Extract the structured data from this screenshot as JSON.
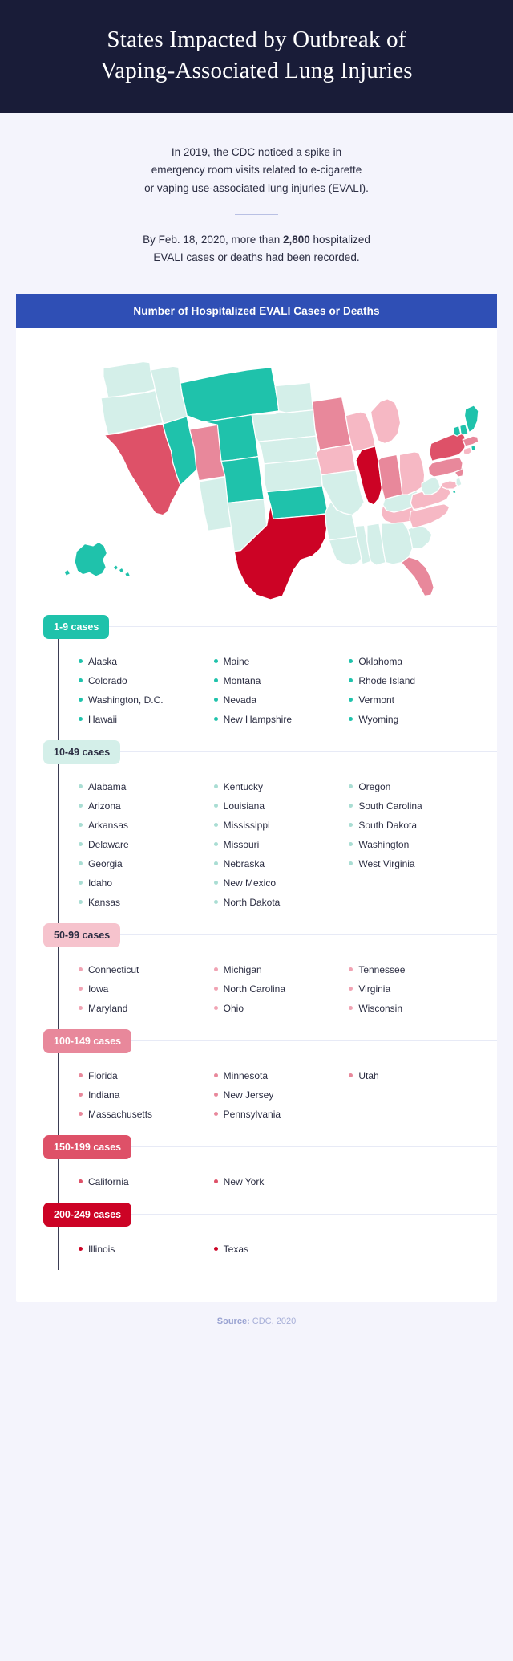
{
  "header": {
    "title_line1": "States Impacted by Outbreak of",
    "title_line2": "Vaping-Associated Lung Injuries"
  },
  "intro": {
    "para1_line1": "In 2019, the CDC noticed a spike in",
    "para1_line2": "emergency room visits related to e-cigarette",
    "para1_line3": "or vaping use-associated lung injuries (EVALI).",
    "para2_pre": "By Feb. 18, 2020, more than ",
    "para2_bold": "2,800",
    "para2_post": " hospitalized",
    "para2_line2": "EVALI cases or deaths had been recorded."
  },
  "card": {
    "title": "Number of Hospitalized EVALI Cases or Deaths"
  },
  "footer": {
    "source_label": "Source:",
    "source_value": " CDC, 2020"
  },
  "colors": {
    "header_bg": "#191c38",
    "page_bg": "#f4f4fc",
    "card_header_bg": "#2f4fb5",
    "bin_1_9": "#1fc2ab",
    "bin_10_49": "#d4efe9",
    "bin_50_99": "#f6b8c4",
    "bin_100_149": "#e8889b",
    "bin_150_199": "#de5168",
    "bin_200_249": "#cc0325",
    "map_stroke": "#ffffff",
    "timeline": "#3b3d54"
  },
  "chart_data": {
    "type": "map",
    "title": "Number of Hospitalized EVALI Cases or Deaths",
    "legend_position": "below",
    "bins": [
      {
        "label": "1-9 cases",
        "color": "#1fc2ab",
        "badge_bg": "#1fc2ab",
        "badge_text": "#ffffff",
        "dot": "#1fc2ab"
      },
      {
        "label": "10-49 cases",
        "color": "#d4efe9",
        "badge_bg": "#d4efe9",
        "badge_text": "#2b2d42",
        "dot": "#a9ddd3"
      },
      {
        "label": "50-99 cases",
        "color": "#f6b8c4",
        "badge_bg": "#f6c3cd",
        "badge_text": "#2b2d42",
        "dot": "#f0a3b3"
      },
      {
        "label": "100-149 cases",
        "color": "#e8889b",
        "badge_bg": "#e8889b",
        "badge_text": "#ffffff",
        "dot": "#e8889b"
      },
      {
        "label": "150-199 cases",
        "color": "#de5168",
        "badge_bg": "#de5168",
        "badge_text": "#ffffff",
        "dot": "#de5168"
      },
      {
        "label": "200-249 cases",
        "color": "#cc0325",
        "badge_bg": "#cc0325",
        "badge_text": "#ffffff",
        "dot": "#cc0325"
      }
    ],
    "groups": [
      {
        "label": "1-9 cases",
        "states": [
          "Alaska",
          "Colorado",
          "Washington, D.C.",
          "Hawaii",
          "Maine",
          "Montana",
          "Nevada",
          "New Hampshire",
          "Oklahoma",
          "Rhode Island",
          "Vermont",
          "Wyoming"
        ]
      },
      {
        "label": "10-49 cases",
        "states": [
          "Alabama",
          "Arizona",
          "Arkansas",
          "Delaware",
          "Georgia",
          "Idaho",
          "Kansas",
          "Kentucky",
          "Louisiana",
          "Mississippi",
          "Missouri",
          "Nebraska",
          "New Mexico",
          "North Dakota",
          "Oregon",
          "South Carolina",
          "South Dakota",
          "Washington",
          "West Virginia"
        ]
      },
      {
        "label": "50-99 cases",
        "states": [
          "Connecticut",
          "Iowa",
          "Maryland",
          "Michigan",
          "North Carolina",
          "Ohio",
          "Tennessee",
          "Virginia",
          "Wisconsin"
        ]
      },
      {
        "label": "100-149 cases",
        "states": [
          "Florida",
          "Indiana",
          "Massachusetts",
          "Minnesota",
          "New Jersey",
          "Pennsylvania",
          "Utah"
        ]
      },
      {
        "label": "150-199 cases",
        "states": [
          "California",
          "New York"
        ]
      },
      {
        "label": "200-249 cases",
        "states": [
          "Illinois",
          "Texas"
        ]
      }
    ],
    "state_bins": {
      "AK": "1-9",
      "CO": "1-9",
      "DC": "1-9",
      "HI": "1-9",
      "ME": "1-9",
      "MT": "1-9",
      "NV": "1-9",
      "NH": "1-9",
      "OK": "1-9",
      "RI": "1-9",
      "VT": "1-9",
      "WY": "1-9",
      "AL": "10-49",
      "AZ": "10-49",
      "AR": "10-49",
      "DE": "10-49",
      "GA": "10-49",
      "ID": "10-49",
      "KS": "10-49",
      "KY": "10-49",
      "LA": "10-49",
      "MS": "10-49",
      "MO": "10-49",
      "NE": "10-49",
      "NM": "10-49",
      "ND": "10-49",
      "OR": "10-49",
      "SC": "10-49",
      "SD": "10-49",
      "WA": "10-49",
      "WV": "10-49",
      "CT": "50-99",
      "IA": "50-99",
      "MD": "50-99",
      "MI": "50-99",
      "NC": "50-99",
      "OH": "50-99",
      "TN": "50-99",
      "VA": "50-99",
      "WI": "50-99",
      "FL": "100-149",
      "IN": "100-149",
      "MA": "100-149",
      "MN": "100-149",
      "NJ": "100-149",
      "PA": "100-149",
      "UT": "100-149",
      "CA": "150-199",
      "NY": "150-199",
      "IL": "200-249",
      "TX": "200-249"
    }
  }
}
